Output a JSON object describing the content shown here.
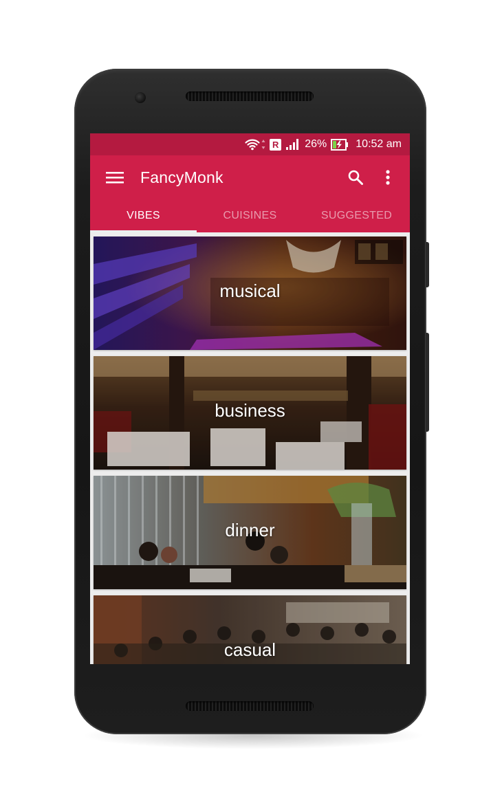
{
  "status_bar": {
    "battery": "26%",
    "time": "10:52 am",
    "roaming_badge": "R",
    "icons": [
      "wifi-icon",
      "roaming-icon",
      "signal-icon",
      "battery-charging-icon"
    ]
  },
  "app_bar": {
    "title": "FancyMonk",
    "menu_icon": "hamburger-menu-icon",
    "search_icon": "search-icon",
    "more_icon": "more-vert-icon"
  },
  "tabs": [
    {
      "label": "VIBES",
      "active": true
    },
    {
      "label": "CUISINES",
      "active": false
    },
    {
      "label": "SUGGESTED",
      "active": false
    }
  ],
  "vibes": [
    {
      "label": "musical"
    },
    {
      "label": "business"
    },
    {
      "label": "dinner"
    },
    {
      "label": "casual"
    }
  ],
  "colors": {
    "status_bar": "#b41a40",
    "app_bar": "#cf1f49",
    "tab_indicator": "#e9f0f0",
    "list_background": "#ededed"
  }
}
